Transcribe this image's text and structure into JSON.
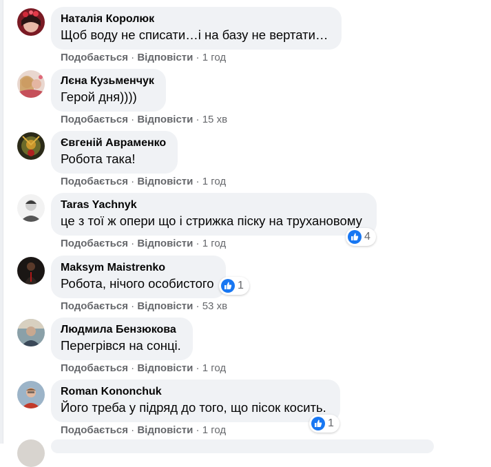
{
  "comments": [
    {
      "author": "Наталія Королюк",
      "text": "Щоб воду не списати…і на базу не вертати…",
      "like": "Подобається",
      "reply": "Відповісти",
      "time": "1 год",
      "reactions": null
    },
    {
      "author": "Лєна Кузьменчук",
      "text": "Герой дня))))",
      "like": "Подобається",
      "reply": "Відповісти",
      "time": "15 хв",
      "reactions": null
    },
    {
      "author": "Євгеній Авраменко",
      "text": "Робота така!",
      "like": "Подобається",
      "reply": "Відповісти",
      "time": "1 год",
      "reactions": null
    },
    {
      "author": "Taras Yachnyk",
      "text": "це з тої ж опери що і стрижка піску на трухановому",
      "like": "Подобається",
      "reply": "Відповісти",
      "time": "1 год",
      "reactions": "4"
    },
    {
      "author": "Maksym Maistrenko",
      "text": "Робота, нічого особистого",
      "like": "Подобається",
      "reply": "Відповісти",
      "time": "53 хв",
      "reactions": "1"
    },
    {
      "author": "Людмила Бензюкова",
      "text": "Перегрівся на сонці.",
      "like": "Подобається",
      "reply": "Відповісти",
      "time": "1 год",
      "reactions": null
    },
    {
      "author": "Roman Kononchuk",
      "text": "Його треба у підряд до того, що пісок косить.",
      "like": "Подобається",
      "reply": "Відповісти",
      "time": "1 год",
      "reactions": "1"
    }
  ],
  "separator": " · ",
  "colors": {
    "bubble": "#f0f2f5",
    "meta": "#65676b",
    "text": "#050505",
    "like_blue": "#1877f2"
  },
  "icons": {
    "reaction": "like-thumbs-up-icon"
  }
}
